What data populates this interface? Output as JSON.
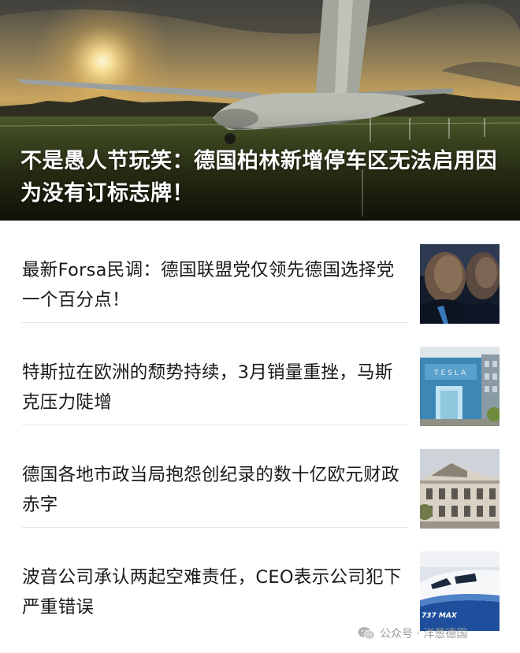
{
  "hero": {
    "title": "不是愚人节玩笑：德国柏林新增停车区无法启用因为没有订标志牌！"
  },
  "news": [
    {
      "title": "最新Forsa民调：德国联盟党仅领先德国选择党一个百分点！",
      "thumb_icon": "politicians-photo"
    },
    {
      "title": "特斯拉在欧洲的颓势持续，3月销量重挫，马斯克压力陡增",
      "thumb_icon": "tesla-store-photo"
    },
    {
      "title": "德国各地市政当局抱怨创纪录的数十亿欧元财政赤字",
      "thumb_icon": "city-hall-photo"
    },
    {
      "title": "波音公司承认两起空难责任，CEO表示公司犯下严重错误",
      "thumb_icon": "boeing-737-max-photo"
    }
  ],
  "thumb_texts": {
    "boeing_label": "737 MAX"
  },
  "watermark": {
    "text": "公众号 · 洋葱德国"
  },
  "colors": {
    "hero_title": "#ffffff",
    "news_title": "#1a1a1a",
    "divider": "#e6e6e6",
    "watermark": "#9a9a9a"
  }
}
